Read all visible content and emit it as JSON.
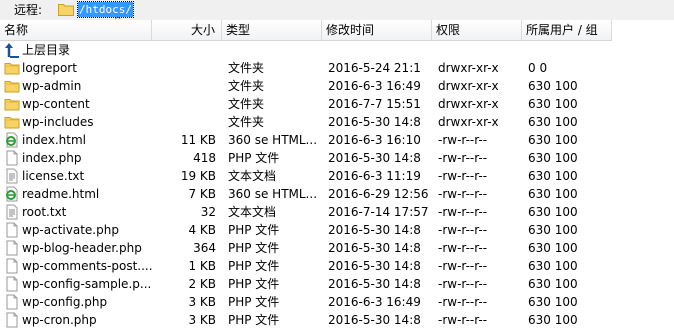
{
  "pathbar": {
    "label": "远程:",
    "path": "/htdocs/"
  },
  "columns": {
    "name": "名称",
    "size": "大小",
    "type": "类型",
    "modified": "修改时间",
    "perms": "权限",
    "owner": "所属用户 / 组"
  },
  "parent": {
    "label": "上层目录",
    "icon": "parent-folder-icon"
  },
  "files": [
    {
      "name": "logreport",
      "size": "",
      "type": "文件夹",
      "date": "2016-5-24 21:1",
      "perm": "drwxr-xr-x",
      "owner": "0 0",
      "icon": "folder"
    },
    {
      "name": "wp-admin",
      "size": "",
      "type": "文件夹",
      "date": "2016-6-3 16:49",
      "perm": "drwxr-xr-x",
      "owner": "630 100",
      "icon": "folder"
    },
    {
      "name": "wp-content",
      "size": "",
      "type": "文件夹",
      "date": "2016-7-7 15:51",
      "perm": "drwxr-xr-x",
      "owner": "630 100",
      "icon": "folder"
    },
    {
      "name": "wp-includes",
      "size": "",
      "type": "文件夹",
      "date": "2016-5-30 14:8",
      "perm": "drwxr-xr-x",
      "owner": "630 100",
      "icon": "folder"
    },
    {
      "name": "index.html",
      "size": "11 KB",
      "type": "360 se HTML...",
      "date": "2016-6-3 16:10",
      "perm": "-rw-r--r--",
      "owner": "630 100",
      "icon": "html"
    },
    {
      "name": "index.php",
      "size": "418",
      "type": "PHP 文件",
      "date": "2016-5-30 14:8",
      "perm": "-rw-r--r--",
      "owner": "630 100",
      "icon": "file"
    },
    {
      "name": "license.txt",
      "size": "19 KB",
      "type": "文本文档",
      "date": "2016-6-3 11:19",
      "perm": "-rw-r--r--",
      "owner": "630 100",
      "icon": "text"
    },
    {
      "name": "readme.html",
      "size": "7 KB",
      "type": "360 se HTML...",
      "date": "2016-6-29 12:56",
      "perm": "-rw-r--r--",
      "owner": "630 100",
      "icon": "html"
    },
    {
      "name": "root.txt",
      "size": "32",
      "type": "文本文档",
      "date": "2016-7-14 17:57",
      "perm": "-rw-r--r--",
      "owner": "630 100",
      "icon": "text"
    },
    {
      "name": "wp-activate.php",
      "size": "4 KB",
      "type": "PHP 文件",
      "date": "2016-5-30 14:8",
      "perm": "-rw-r--r--",
      "owner": "630 100",
      "icon": "file"
    },
    {
      "name": "wp-blog-header.php",
      "size": "364",
      "type": "PHP 文件",
      "date": "2016-5-30 14:8",
      "perm": "-rw-r--r--",
      "owner": "630 100",
      "icon": "file"
    },
    {
      "name": "wp-comments-post....",
      "size": "1 KB",
      "type": "PHP 文件",
      "date": "2016-5-30 14:8",
      "perm": "-rw-r--r--",
      "owner": "630 100",
      "icon": "file"
    },
    {
      "name": "wp-config-sample.p...",
      "size": "2 KB",
      "type": "PHP 文件",
      "date": "2016-5-30 14:8",
      "perm": "-rw-r--r--",
      "owner": "630 100",
      "icon": "file"
    },
    {
      "name": "wp-config.php",
      "size": "3 KB",
      "type": "PHP 文件",
      "date": "2016-6-3 16:49",
      "perm": "-rw-r--r--",
      "owner": "630 100",
      "icon": "file"
    },
    {
      "name": "wp-cron.php",
      "size": "3 KB",
      "type": "PHP 文件",
      "date": "2016-5-30 14:8",
      "perm": "-rw-r--r--",
      "owner": "630 100",
      "icon": "file"
    }
  ],
  "colors": {
    "selection": "#3399ff",
    "folder": "#f2c94c",
    "html_icon": "#2e9c3a"
  }
}
